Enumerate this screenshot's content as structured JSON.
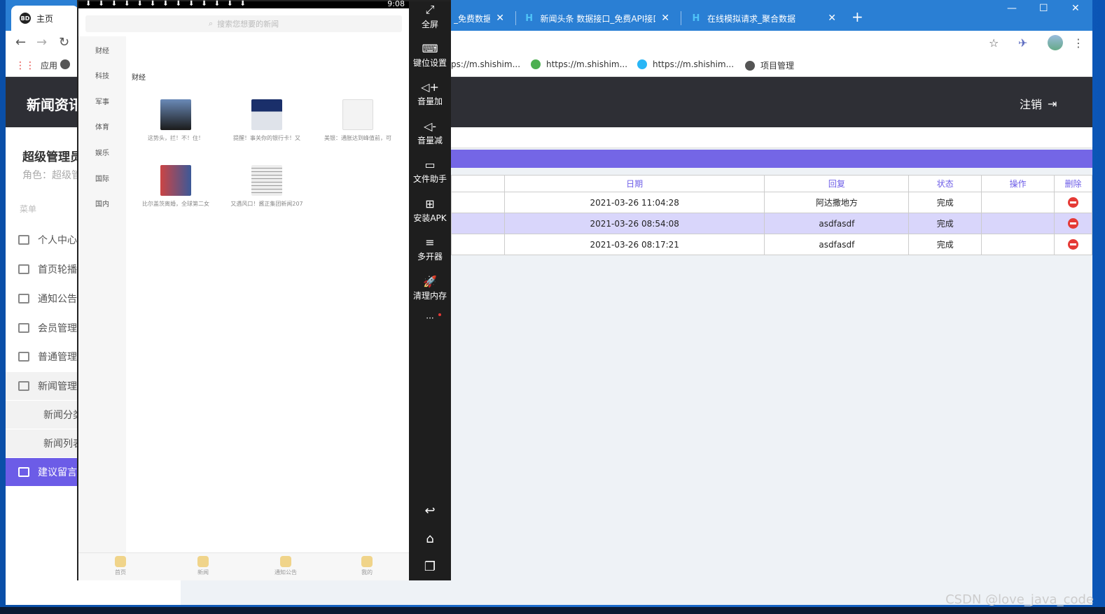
{
  "browser": {
    "tabs": [
      {
        "label": "主页",
        "icon": "BD"
      },
      {
        "label": "_免费数据",
        "icon": ""
      },
      {
        "label": "新闻头条 数据接口_免费API接口",
        "icon": "H"
      },
      {
        "label": "在线模拟请求_聚合数据",
        "icon": "H"
      }
    ],
    "new_tab": "+",
    "bookmarks": [
      "应用",
      "ps://m.shishim...",
      "https://m.shishim...",
      "https://m.shishim...",
      "项目管理"
    ]
  },
  "app": {
    "logo": "新闻资讯",
    "logout": "注销",
    "user_name": "超级管理员",
    "role": "角色：超级管理员",
    "menu_label": "菜单",
    "menu": [
      "个人中心",
      "首页轮播",
      "通知公告",
      "会员管理",
      "普通管理",
      "新闻管理"
    ],
    "submenu": [
      "新闻分类",
      "新闻列表"
    ],
    "active_menu": "建议留言",
    "table": {
      "headers": [
        "日期",
        "回复",
        "状态",
        "操作",
        "删除"
      ],
      "rows": [
        {
          "date": "2021-03-26 11:04:28",
          "reply": "阿达撒地方",
          "status": "完成"
        },
        {
          "date": "2021-03-26 08:54:08",
          "reply": "asdfasdf",
          "status": "完成"
        },
        {
          "date": "2021-03-26 08:17:21",
          "reply": "asdfasdf",
          "status": "完成"
        }
      ]
    }
  },
  "emulator": {
    "time": "9:08",
    "search_placeholder": "搜索您想要的新闻",
    "categories": [
      "财经",
      "科技",
      "军事",
      "体育",
      "娱乐",
      "国际",
      "国内"
    ],
    "section_title": "财经",
    "news": [
      "这势头，拦！不！住！",
      "提醒！事关你的银行卡！又",
      "美银：通胀达到峰值前，可",
      "比尔盖茨离婚，全球第二女",
      "又遇风口！酱正集团新闻207"
    ],
    "tabs": [
      "首页",
      "新闻",
      "通知公告",
      "我的"
    ],
    "side_buttons": [
      "全屏",
      "键位设置",
      "音量加",
      "音量减",
      "文件助手",
      "安装APK",
      "多开器",
      "清理内存"
    ]
  },
  "watermark": "CSDN @love_java_code",
  "colors": {
    "accent": "#6c5ce7",
    "header": "#2e2f35",
    "delete": "#e53935"
  }
}
